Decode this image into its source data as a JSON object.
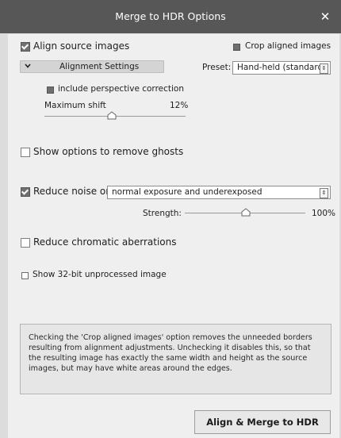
{
  "window": {
    "title": "Merge to HDR Options",
    "close_glyph": "✕"
  },
  "options": {
    "align_source_images": {
      "label": "Align source images",
      "checked": true
    },
    "crop_aligned_images": {
      "label": "Crop aligned images",
      "checked": true
    },
    "alignment_settings": {
      "label": "Alignment Settings",
      "chevron": "⌄",
      "expanded": true
    },
    "preset": {
      "label": "Preset:",
      "value": "Hand-held (standard)"
    },
    "perspective_correction": {
      "label": "include perspective correction",
      "checked": true
    },
    "maximum_shift": {
      "label": "Maximum shift",
      "value_text": "12%",
      "value": 0.12
    },
    "show_ghost_options": {
      "label": "Show options to remove ghosts",
      "checked": false
    },
    "reduce_noise": {
      "label": "Reduce noise on",
      "checked": true,
      "dropdown_value": "normal exposure and underexposed",
      "strength_label": "Strength:",
      "strength_text": "100%",
      "strength": 1.0
    },
    "reduce_chromatic": {
      "label": "Reduce chromatic aberrations",
      "checked": false
    },
    "show_32bit": {
      "label": "Show 32-bit unprocessed image",
      "checked": false
    }
  },
  "info_text": "Checking the 'Crop aligned images' option removes the unneeded borders resulting from alignment adjustments. Unchecking it disables this, so that the resulting image has exactly the same width and height as the source images, but may have white areas around the edges.",
  "buttons": {
    "merge": "Align & Merge to HDR"
  },
  "icons": {
    "close": "close-icon",
    "chevron": "chevron-down-icon",
    "dropdown_arrow": "updown-arrow-icon",
    "slider_thumb": "slider-thumb-icon"
  },
  "colors": {
    "titlebar": "#575757",
    "dialog": "#efefef",
    "window_bg": "#dcdcdc",
    "info_box": "#e6e6e6"
  }
}
